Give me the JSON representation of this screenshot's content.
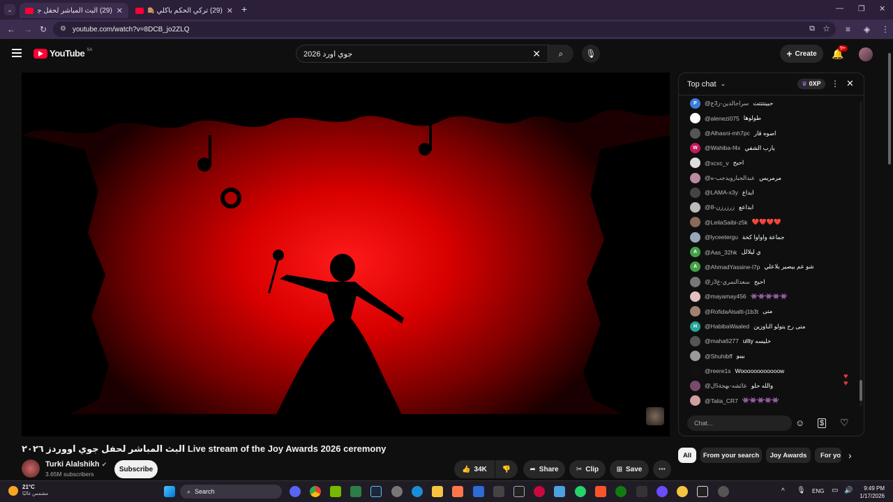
{
  "tabs": [
    {
      "title": "(29) البث المباشر لحفل جوي"
    },
    {
      "title": "(29) تركي الحكم باكلي 🙈 طلعت"
    }
  ],
  "address": {
    "url": "youtube.com/watch?v=8DCB_jo2ZLQ"
  },
  "youtube": {
    "logo": "YouTube",
    "region": "SA",
    "search_value": "جوي اورد 2026",
    "create_label": "Create",
    "notif_badge": "9+"
  },
  "chat": {
    "header": "Top chat",
    "points": "0XP",
    "input_placeholder": "Chat...",
    "messages": [
      {
        "author": "@سراجالدين-ز3ع",
        "text": "حبيتتتتت",
        "avatar": "P",
        "color": "#3b7ddd"
      },
      {
        "author": "@alenezi075",
        "text": "طولوها",
        "avatar": "",
        "color": "#ffffff"
      },
      {
        "author": "@Alhasni-mh7pc",
        "text": "اصوه قار",
        "avatar": "",
        "color": "#555555"
      },
      {
        "author": "@Wahiba-f4x",
        "text": "يارب الشفي",
        "avatar": "W",
        "color": "#c2185b"
      },
      {
        "author": "@xcxc_v",
        "text": "احبح",
        "avatar": "",
        "color": "#dddddd"
      },
      {
        "author": "@عبدالجبارويدجب-ه",
        "text": "مرمريس",
        "avatar": "",
        "color": "#b98aa0"
      },
      {
        "author": "@LAMA-x3y",
        "text": "ابداع",
        "avatar": "",
        "color": "#444444"
      },
      {
        "author": "@زرزرزن-8",
        "text": "ابداعع",
        "avatar": "",
        "color": "#bbbbbb"
      },
      {
        "author": "@LeilaSaibi-z5k",
        "text": "❤️❤️❤️❤️",
        "avatar": "",
        "color": "#8a6a5a"
      },
      {
        "author": "@lyceetergu",
        "text": "جماعة واواوا كخة",
        "avatar": "",
        "color": "#9aa7b8"
      },
      {
        "author": "@Aas_32hk",
        "text": "ي ليلالل",
        "avatar": "A",
        "color": "#43a047"
      },
      {
        "author": "@AhmadYassine-l7p",
        "text": "شو عم بيصير بلاعلي",
        "avatar": "A",
        "color": "#43a047"
      },
      {
        "author": "@سعدالنمري-غ3ز",
        "text": "احبح",
        "avatar": "",
        "color": "#777777"
      },
      {
        "author": "@mayamay456",
        "text": "👾👾👾👾👾",
        "avatar": "",
        "color": "#e0c0c0"
      },
      {
        "author": "@RofidaAlsalti-j1b3t",
        "text": "متى",
        "avatar": "",
        "color": "#a08070"
      },
      {
        "author": "@HabibaWaaled",
        "text": "متى رح يتولو الناوزين",
        "avatar": "H",
        "color": "#26a69a"
      },
      {
        "author": "@maha6277",
        "text": "ullty خليسه",
        "avatar": "",
        "color": "#555555"
      },
      {
        "author": "@Shuhibff",
        "text": "بيبو",
        "avatar": "",
        "color": "#999999"
      },
      {
        "author": "@reere1s",
        "text": "Woooooooooooow",
        "avatar": "",
        "color": "#111111"
      },
      {
        "author": "@عائشه-بهجة5ل",
        "text": "والله حلو",
        "avatar": "",
        "color": "#7a4a6a"
      },
      {
        "author": "@Talia_CR7",
        "text": "👾👾👾👾👾",
        "avatar": "",
        "color": "#d0a0a0"
      }
    ]
  },
  "video": {
    "title": "البث المباشر لحفل جوي اووردز ٢٠٢٦ Live stream of the Joy Awards 2026 ceremony",
    "channel": "Turki Alalshikh",
    "subscribers": "3.65M subscribers",
    "subscribe_label": "Subscribe",
    "likes": "34K",
    "share_label": "Share",
    "clip_label": "Clip",
    "save_label": "Save"
  },
  "chips": [
    {
      "label": "All"
    },
    {
      "label": "From your search"
    },
    {
      "label": "Joy Awards"
    },
    {
      "label": "For yo"
    }
  ],
  "taskbar": {
    "weather_temp": "21°C",
    "weather_desc": "مشمس غالبًا",
    "search_label": "Search",
    "lang": "ENG",
    "time": "9:49 PM",
    "date": "1/17/2026"
  },
  "colors": {
    "brand_red": "#ff0033",
    "chat_bg": "#0f0f0f",
    "browser_frame": "#2b1f3a"
  }
}
